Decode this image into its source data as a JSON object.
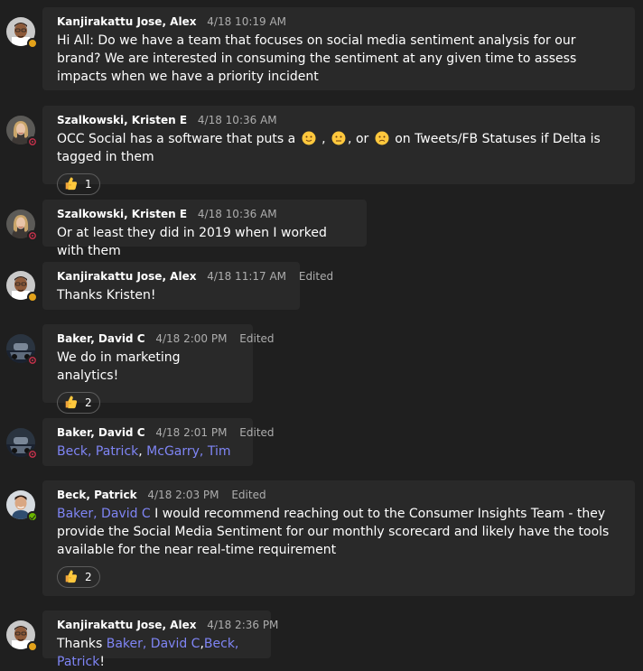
{
  "messages": [
    {
      "author": "Kanjirakattu Jose, Alex",
      "time": "4/18 10:19 AM",
      "edited": "",
      "text": "Hi All: Do we have a team that focuses on social media sentiment analysis for our brand? We are interested in consuming the sentiment at any given time to assess impacts when we have a priority incident"
    },
    {
      "author": "Szalkowski, Kristen E",
      "time": "4/18 10:36 AM",
      "edited": "",
      "text_part1": "OCC Social has a software that puts a",
      "text_part2": ", or",
      "text_part3": "on Tweets/FB Statuses if Delta is tagged in them",
      "reaction_count": "1"
    },
    {
      "author": "Szalkowski, Kristen E",
      "time": "4/18 10:36 AM",
      "edited": "",
      "text": "Or at least they did in 2019 when I worked with them"
    },
    {
      "author": "Kanjirakattu Jose, Alex",
      "time": "4/18 11:17 AM",
      "edited": "Edited",
      "text": "Thanks Kristen!"
    },
    {
      "author": "Baker, David C",
      "time": "4/18 2:00 PM",
      "edited": "Edited",
      "text": "We do in marketing analytics!",
      "reaction_count": "2"
    },
    {
      "author": "Baker, David C",
      "time": "4/18 2:01 PM",
      "edited": "Edited",
      "mention1": "Beck, Patrick",
      "separator": ",",
      "mention2": "McGarry, Tim"
    },
    {
      "author": "Beck, Patrick",
      "time": "4/18 2:03 PM",
      "edited": "Edited",
      "mention": "Baker, David C",
      "text_rest": "I would recommend reaching out to the Consumer Insights Team - they provide the Social Media Sentiment for our monthly scorecard and likely have the tools available for the near real-time requirement",
      "reaction_count": "2"
    },
    {
      "author": "Kanjirakattu Jose, Alex",
      "time": "4/18 2:36 PM",
      "edited": "",
      "prefix": "Thanks",
      "mention1": "Baker, David C",
      "separator": ",",
      "mention2": "Beck, Patrick",
      "suffix": "!"
    }
  ],
  "icons": {
    "reaction": "thumbs-up-emoji",
    "emoji_smile": "slightly-smiling-face",
    "emoji_neutral": "neutral-face",
    "emoji_frown": "slightly-frowning-face"
  },
  "colors": {
    "background": "#1f1f1f",
    "bubble": "#292929",
    "mention": "#7f85f5",
    "away": "#e3a21a",
    "available": "#6bb700",
    "dnd": "#c4314b"
  }
}
